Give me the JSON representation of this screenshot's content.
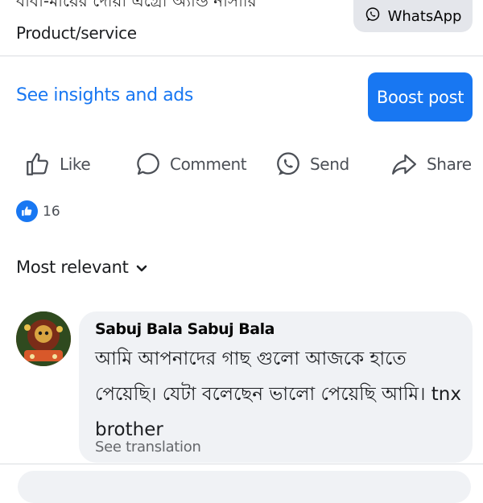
{
  "page_header": {
    "name_partial": "বাবা-মায়ের দোয়া এগ্রো অ্যান্ড নার্সারি",
    "category": "Product/service",
    "whatsapp_label": "WhatsApp"
  },
  "promo": {
    "insights_label": "See insights and ads",
    "boost_label": "Boost post"
  },
  "actions": {
    "like": "Like",
    "comment": "Comment",
    "send": "Send",
    "share": "Share"
  },
  "reactions": {
    "count": "16"
  },
  "comments": {
    "sort_label": "Most relevant",
    "items": [
      {
        "author": "Sabuj Bala Sabuj Bala",
        "text": "আমি আপনাদের গাছ গুলো আজকে হাতে পেয়েছি। যেটা বলেছেন ভালো পেয়েছি আমি। tnx brother",
        "translation_label": "See translation"
      }
    ]
  },
  "colors": {
    "accent": "#1877f2",
    "bubble": "#f0f2f5",
    "secondary_text": "#65676b"
  }
}
